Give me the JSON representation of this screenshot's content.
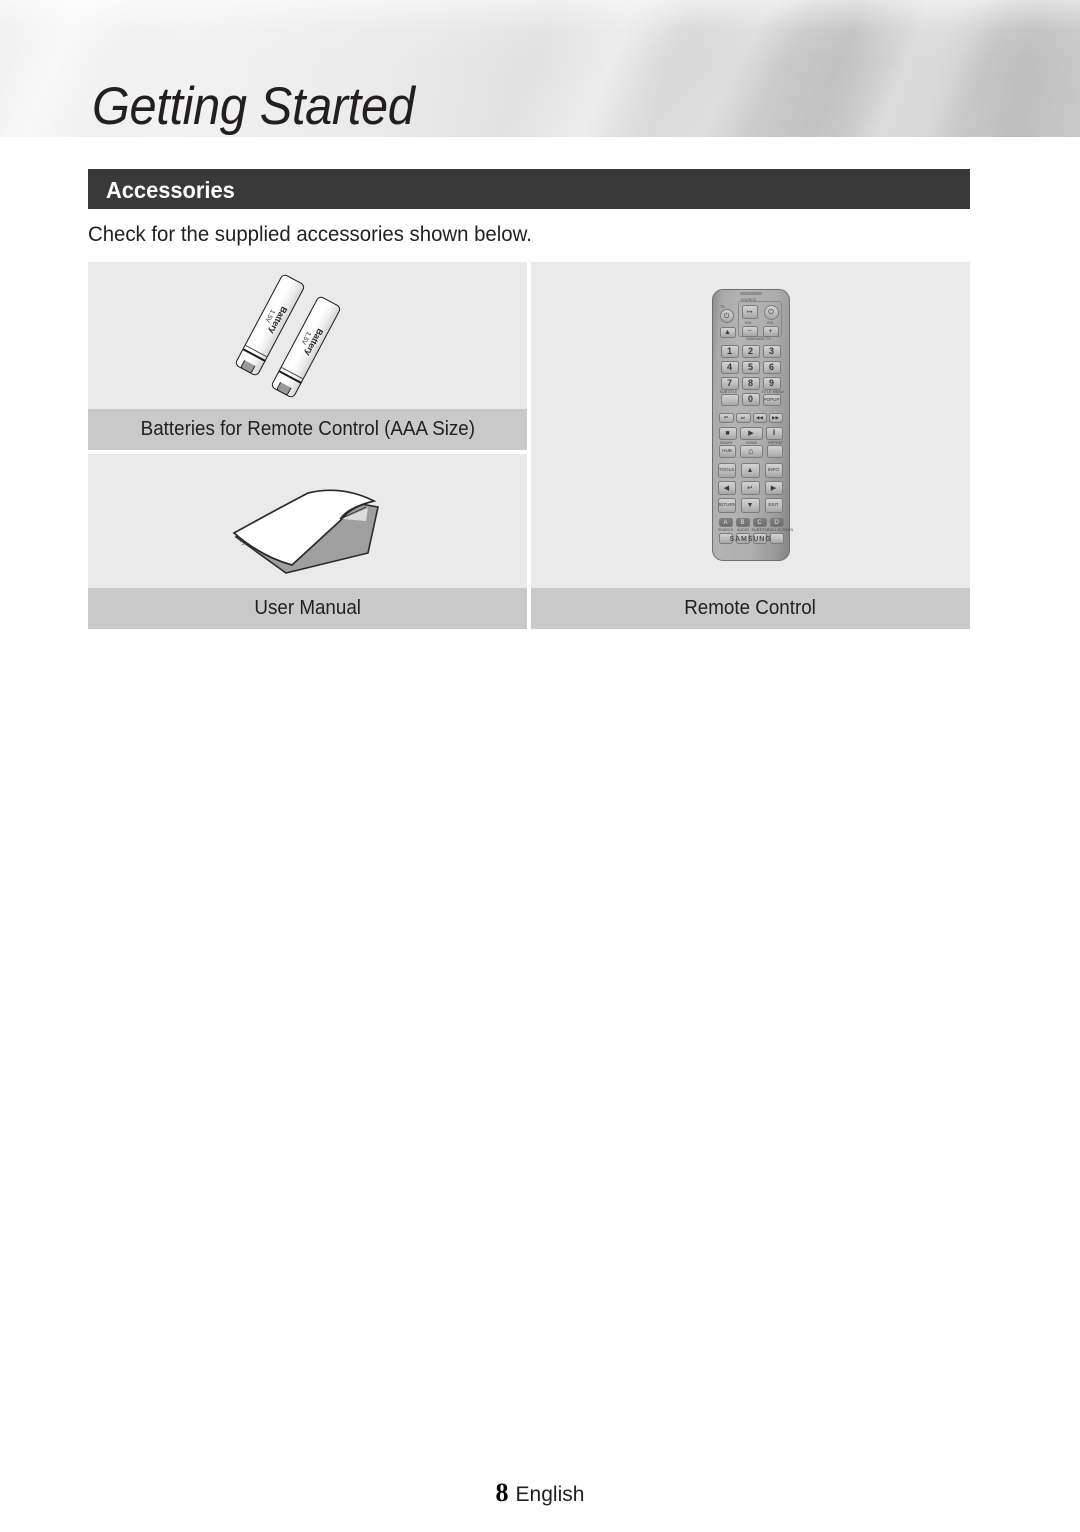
{
  "page": {
    "chapter_title": "Getting Started",
    "section_title": "Accessories",
    "intro_text": "Check for the supplied accessories shown below.",
    "footer_page_number": "8",
    "footer_language": "English",
    "colors": {
      "section_bar_bg": "#393939",
      "section_bar_text": "#ffffff",
      "cell_image_bg": "#eaeaea",
      "cell_label_bg": "#c9c9c9",
      "body_text": "#231f20"
    }
  },
  "accessories": {
    "columns": [
      {
        "cells": [
          {
            "illustration": "batteries",
            "label": "Batteries for Remote Control (AAA Size)"
          },
          {
            "illustration": "user-manual",
            "label": "User Manual"
          }
        ]
      },
      {
        "cells": [
          {
            "illustration": "remote-control",
            "label": "Remote Control"
          }
        ]
      }
    ]
  },
  "battery_illustration": {
    "count": 2,
    "text": "Battery",
    "voltage": "1.5V"
  },
  "remote": {
    "brand": "SAMSUNG",
    "group_labels": {
      "source": "SOURCE",
      "vol_minus": "VOL",
      "vol_plus": "VOL",
      "tv_group": "SAMSUNG TV",
      "subtitle": "SUBTITLE",
      "title_menu": "TITLE MENU",
      "smart": "SMART",
      "home": "HOME",
      "repeat": "REPEAT",
      "search": "SEARCH",
      "audio": "AUDIO",
      "subtitle2": "SUBTITLE",
      "full_screen": "FULL SCREEN"
    },
    "keys": {
      "power_tv": "⏻",
      "source": "↦",
      "power": "⏻",
      "eject": "▲",
      "vol_minus": "−",
      "vol_plus": "+",
      "n1": "1",
      "n2": "2",
      "n3": "3",
      "n4": "4",
      "n5": "5",
      "n6": "6",
      "n7": "7",
      "n8": "8",
      "n9": "9",
      "n0": "0",
      "popup": "POPUP",
      "prev": "⏮",
      "next": "⏭",
      "rew": "◀◀",
      "ff": "▶▶",
      "stop": "■",
      "play": "▶",
      "pause": "‖",
      "hub": "HUB",
      "home": "⌂",
      "repeat": "",
      "tools": "TOOLS",
      "up": "▲",
      "info": "INFO",
      "left": "◀",
      "enter": "↵",
      "right": "▶",
      "return": "RETURN",
      "down": "▼",
      "exit": "EXIT",
      "color_a": "A",
      "color_b": "B",
      "color_c": "C",
      "color_d": "D"
    }
  }
}
